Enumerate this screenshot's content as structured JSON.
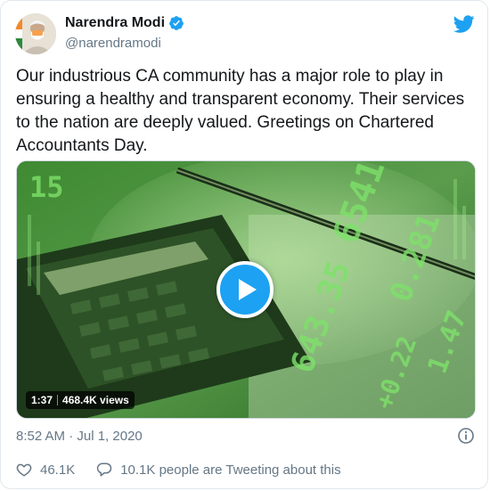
{
  "author": {
    "name": "Narendra Modi",
    "handle": "@narendramodi",
    "verified": true
  },
  "tweet": {
    "text": "Our industrious CA community has a major role to play in ensuring a healthy and transparent economy. Their services to the nation are deeply valued. Greetings on Chartered Accountants Day."
  },
  "media": {
    "duration": "1:37",
    "views": "468.4K views"
  },
  "timestamp": "8:52 AM · Jul 1, 2020",
  "actions": {
    "likes": "46.1K",
    "retweet_text": "10.1K people are Tweeting about this"
  },
  "colors": {
    "brand": "#1da1f2",
    "text": "#14171a",
    "muted": "#657786",
    "verified": "#1da1f2"
  },
  "icons": {
    "brand": "twitter-bird-icon",
    "verified": "verified-badge-icon",
    "play": "play-icon",
    "info": "info-icon",
    "like": "heart-icon",
    "reply": "speech-bubble-icon"
  }
}
